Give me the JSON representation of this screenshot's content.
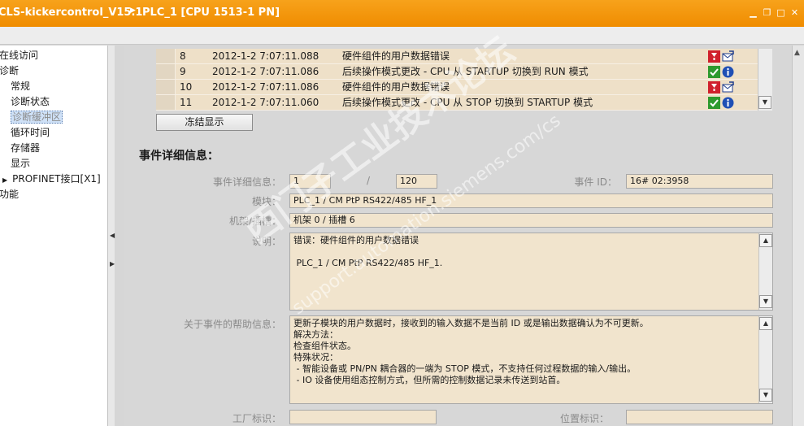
{
  "titlebar": {
    "project": "CLS-kickercontrol_V15.1",
    "device": "PLC_1 [CPU 1513-1 PN]"
  },
  "nav": {
    "items": [
      {
        "label": "在线访问"
      },
      {
        "label": "诊断"
      },
      {
        "label": "常规"
      },
      {
        "label": "诊断状态"
      },
      {
        "label": "诊断缓冲区"
      },
      {
        "label": "循环时间"
      },
      {
        "label": "存储器"
      },
      {
        "label": "显示"
      },
      {
        "label": "PROFINET接口[X1]"
      },
      {
        "label": "功能"
      }
    ],
    "selected_index": 4
  },
  "events": [
    {
      "no": "8",
      "time": "2012-1-2 7:07:11.088",
      "message": "硬件组件的用户数据错误",
      "status": "error",
      "direction": "incoming"
    },
    {
      "no": "9",
      "time": "2012-1-2 7:07:11.086",
      "message": "后续操作模式更改 - CPU 从 STARTUP 切换到 RUN 模式",
      "status": "ok",
      "direction": "info"
    },
    {
      "no": "10",
      "time": "2012-1-2 7:07:11.086",
      "message": "硬件组件的用户数据错误",
      "status": "error",
      "direction": "incoming"
    },
    {
      "no": "11",
      "time": "2012-1-2 7:07:11.060",
      "message": "后续操作模式更改 - CPU 从 STOP 切换到 STARTUP 模式",
      "status": "ok",
      "direction": "info"
    }
  ],
  "freeze_button": "冻结显示",
  "details": {
    "title": "事件详细信息：",
    "event_detail_label": "事件详细信息：",
    "event_index": "1",
    "event_separator": "/",
    "event_total": "120",
    "event_id_label": "事件 ID：",
    "event_id": "16# 02:3958",
    "module_label": "模块：",
    "module": "PLC_1 / CM PtP RS422/485 HF_1",
    "rack_slot_label": "机架/插槽：",
    "rack_slot": "机架 0 / 插槽 6",
    "description_label": "说明：",
    "description": "错误：硬件组件的用户数据错误\n\n PLC_1 / CM PtP RS422/485 HF_1.",
    "help_label": "关于事件的帮助信息：",
    "help": "更新子模块的用户数据时，接收到的输入数据不是当前 ID 或是输出数据确认为不可更新。\n解决方法：\n检查组件状态。\n特殊状况：\n - 智能设备或 PN/PN 耦合器的一端为 STOP 模式，不支持任何过程数据的输入/输出。\n - IO 设备使用组态控制方式，但所需的控制数据记录未传送到站首。",
    "plant_label": "工厂标识：",
    "plant": "",
    "location_label": "位置标识：",
    "location": ""
  },
  "watermark": {
    "line1": "西门子工业技术论坛",
    "line2": "support.automation.siemens.com/cs"
  },
  "colors": {
    "titlebar": "#f39200",
    "field_bg": "#f1e4cd",
    "selection": "#cfe1f7"
  }
}
